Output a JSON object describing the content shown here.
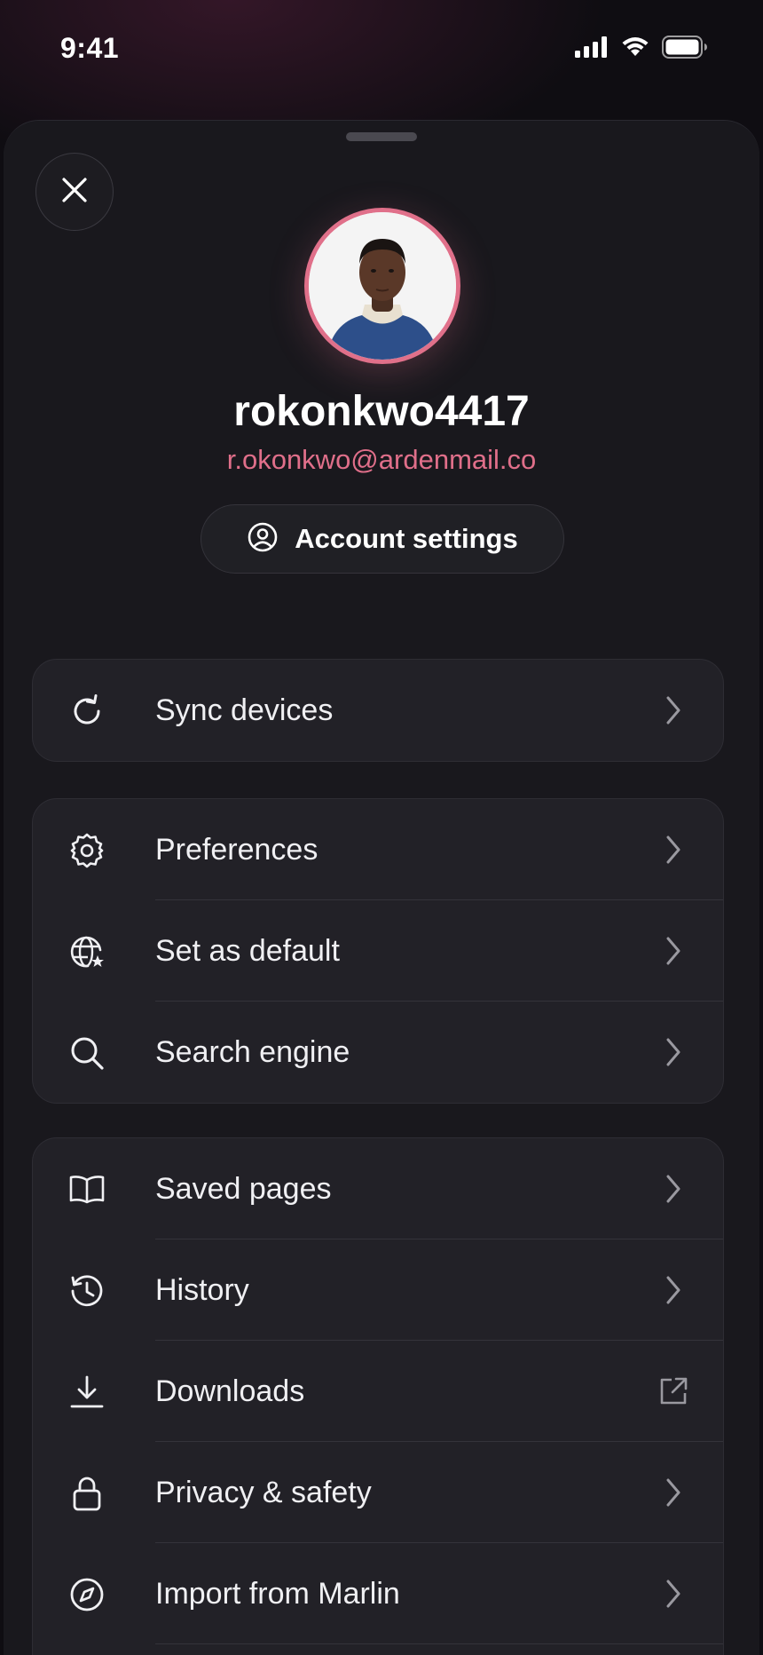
{
  "status_bar": {
    "time": "9:41"
  },
  "profile": {
    "username": "rokonkwo4417",
    "email": "r.okonkwo@ardenmail.co",
    "account_button": "Account settings"
  },
  "groups": [
    {
      "items": [
        {
          "label": "Sync devices",
          "icon": "sync-icon",
          "trail": "chevron"
        }
      ]
    },
    {
      "items": [
        {
          "label": "Preferences",
          "icon": "gear-icon",
          "trail": "chevron"
        },
        {
          "label": "Set as default",
          "icon": "globe-star-icon",
          "trail": "chevron"
        },
        {
          "label": "Search engine",
          "icon": "search-icon",
          "trail": "chevron"
        }
      ]
    },
    {
      "items": [
        {
          "label": "Saved pages",
          "icon": "book-icon",
          "trail": "chevron"
        },
        {
          "label": "History",
          "icon": "history-icon",
          "trail": "chevron"
        },
        {
          "label": "Downloads",
          "icon": "download-icon",
          "trail": "external-link"
        },
        {
          "label": "Privacy & safety",
          "icon": "lock-icon",
          "trail": "chevron"
        },
        {
          "label": "Import from Marlin",
          "icon": "compass-icon",
          "trail": "chevron"
        }
      ]
    }
  ],
  "colors": {
    "accent": "#e06f8a",
    "background": "#0f0d12",
    "sheet": "#19181d",
    "card": "#222127"
  }
}
